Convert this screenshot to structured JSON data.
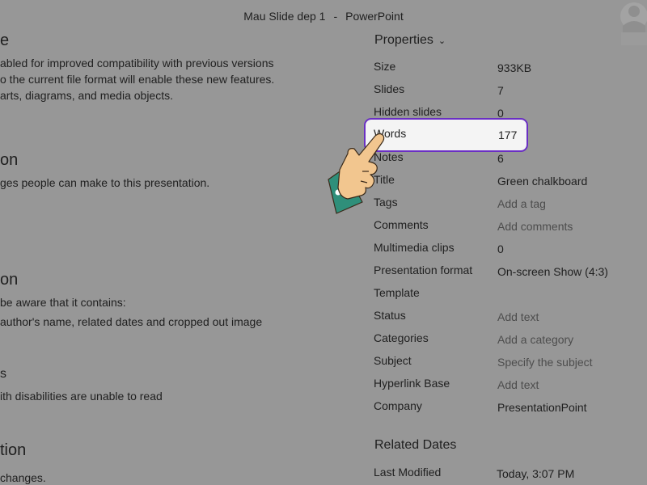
{
  "window": {
    "file_name": "Mau Slide dep 1",
    "separator": "-",
    "app_name": "PowerPoint"
  },
  "left_pane": {
    "sections": [
      {
        "heading": "e",
        "lines": [
          "abled for improved compatibility with previous versions",
          "o the current file format will enable these new features.",
          "arts, diagrams, and media objects."
        ]
      },
      {
        "heading": "on",
        "lines": [
          "ges people can make to this presentation."
        ]
      },
      {
        "heading": "on",
        "lines": [
          "be aware that it contains:",
          "author's name, related dates and cropped out image"
        ]
      },
      {
        "heading": "s",
        "lines": [
          "ith disabilities are unable to read"
        ]
      },
      {
        "heading": "tion",
        "lines": [
          "changes."
        ]
      }
    ]
  },
  "properties": {
    "heading": "Properties",
    "rows": [
      {
        "label": "Size",
        "value": "933KB",
        "placeholder": false
      },
      {
        "label": "Slides",
        "value": "7",
        "placeholder": false
      },
      {
        "label": "Hidden slides",
        "value": "0",
        "placeholder": false
      },
      {
        "label": "Words",
        "value": "177",
        "placeholder": false
      },
      {
        "label": "Notes",
        "value": "6",
        "placeholder": false
      },
      {
        "label": "Title",
        "value": "Green chalkboard",
        "placeholder": false
      },
      {
        "label": "Tags",
        "value": "Add a tag",
        "placeholder": true
      },
      {
        "label": "Comments",
        "value": "Add comments",
        "placeholder": true
      },
      {
        "label": "Multimedia clips",
        "value": "0",
        "placeholder": false
      },
      {
        "label": "Presentation format",
        "value": "On-screen Show (4:3)",
        "placeholder": false
      },
      {
        "label": "Template",
        "value": "",
        "placeholder": false
      },
      {
        "label": "Status",
        "value": "Add text",
        "placeholder": true
      },
      {
        "label": "Categories",
        "value": "Add a category",
        "placeholder": true
      },
      {
        "label": "Subject",
        "value": "Specify the subject",
        "placeholder": true
      },
      {
        "label": "Hyperlink Base",
        "value": "Add text",
        "placeholder": true
      },
      {
        "label": "Company",
        "value": "PresentationPoint",
        "placeholder": false
      }
    ]
  },
  "related_dates": {
    "heading": "Related Dates",
    "rows": [
      {
        "label": "Last Modified",
        "value": "Today, 3:07 PM"
      }
    ]
  },
  "colors": {
    "overlay_background": "#979797",
    "highlight_border": "#6a2fc3",
    "highlight_fill": "#f4f4f4"
  },
  "icons": {
    "account": "account-icon",
    "pointer": "pointing-hand-icon"
  }
}
